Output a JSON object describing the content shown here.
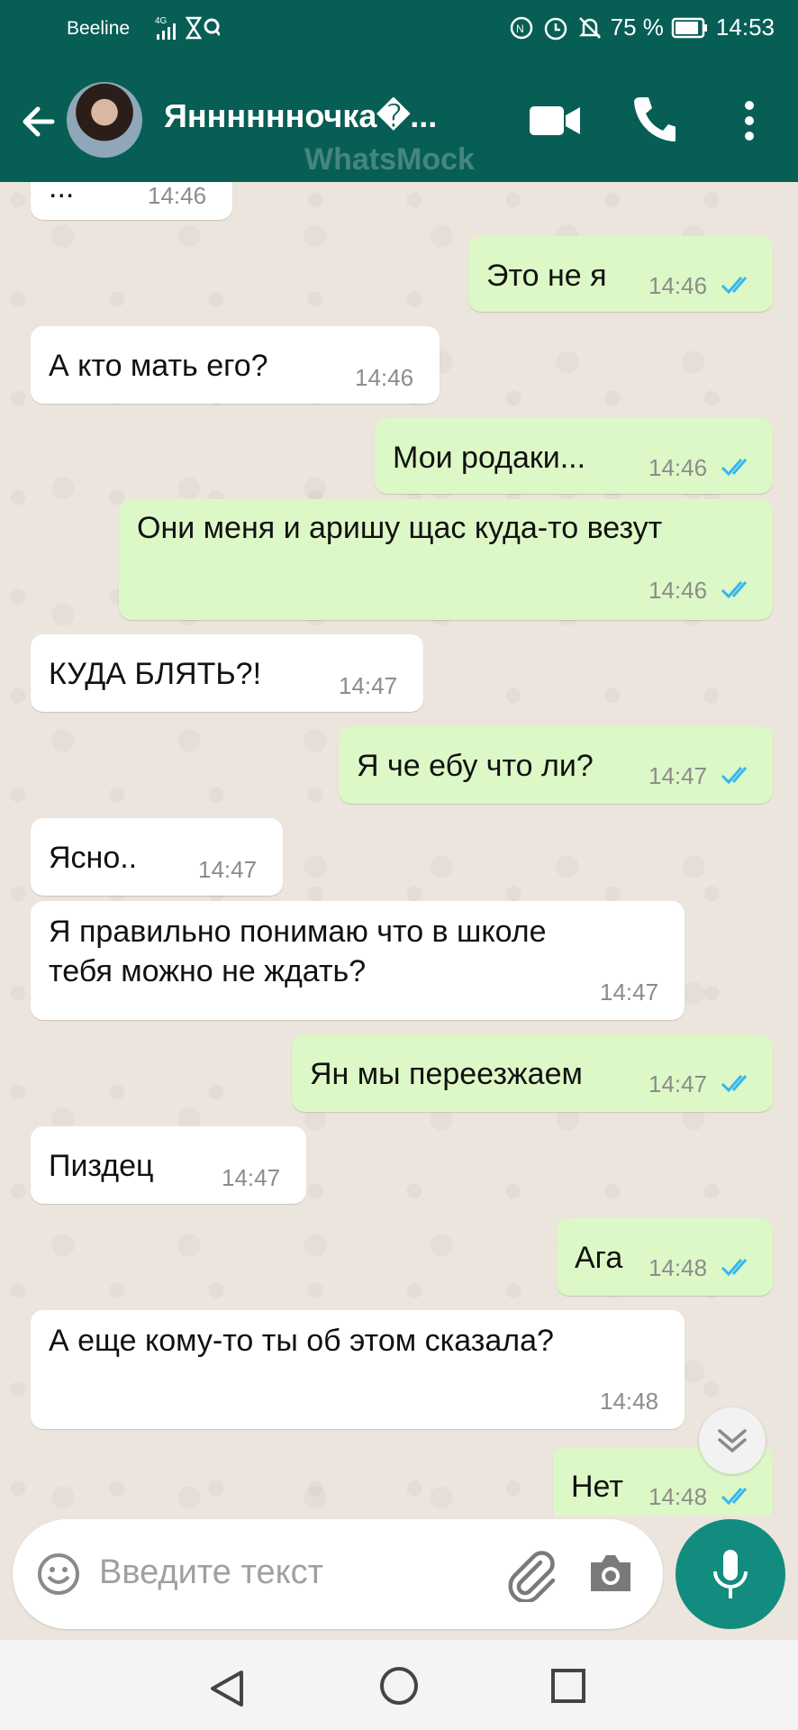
{
  "status": {
    "carrier": "Beeline",
    "network": "4G",
    "battery": "75 %",
    "time": "14:53"
  },
  "header": {
    "contact_name": "Янннннночка�...",
    "watermark": "WhatsMock"
  },
  "messages": [
    {
      "dir": "in",
      "text": "...",
      "time": "14:46"
    },
    {
      "dir": "out",
      "text": "Это не я",
      "time": "14:46"
    },
    {
      "dir": "in",
      "text": "А кто мать его?",
      "time": "14:46"
    },
    {
      "dir": "out",
      "text": "Мои родаки...",
      "time": "14:46"
    },
    {
      "dir": "out",
      "text": "Они меня и аришу щас куда-то везут",
      "time": "14:46"
    },
    {
      "dir": "in",
      "text": "КУДА БЛЯТЬ?!",
      "time": "14:47"
    },
    {
      "dir": "out",
      "text": "Я че ебу что ли?",
      "time": "14:47"
    },
    {
      "dir": "in",
      "text": "Ясно..",
      "time": "14:47"
    },
    {
      "dir": "in",
      "text": " Я правильно понимаю что в школе",
      "text2": "тебя можно не ждать?",
      "time": "14:47"
    },
    {
      "dir": "out",
      "text": "Ян мы переезжаем",
      "time": "14:47"
    },
    {
      "dir": "in",
      "text": "Пиздец",
      "time": "14:47"
    },
    {
      "dir": "out",
      "text": "Ага",
      "time": "14:48"
    },
    {
      "dir": "in",
      "text": "А еще кому-то ты об этом сказала?",
      "time": "14:48"
    },
    {
      "dir": "out",
      "text": "Нет",
      "time": "14:48"
    }
  ],
  "input": {
    "placeholder": "Введите текст"
  },
  "colors": {
    "header": "#075e54",
    "outgoing": "#dcf8c6",
    "incoming": "#ffffff",
    "ticks": "#34b7f1",
    "mic": "#128c7e"
  }
}
